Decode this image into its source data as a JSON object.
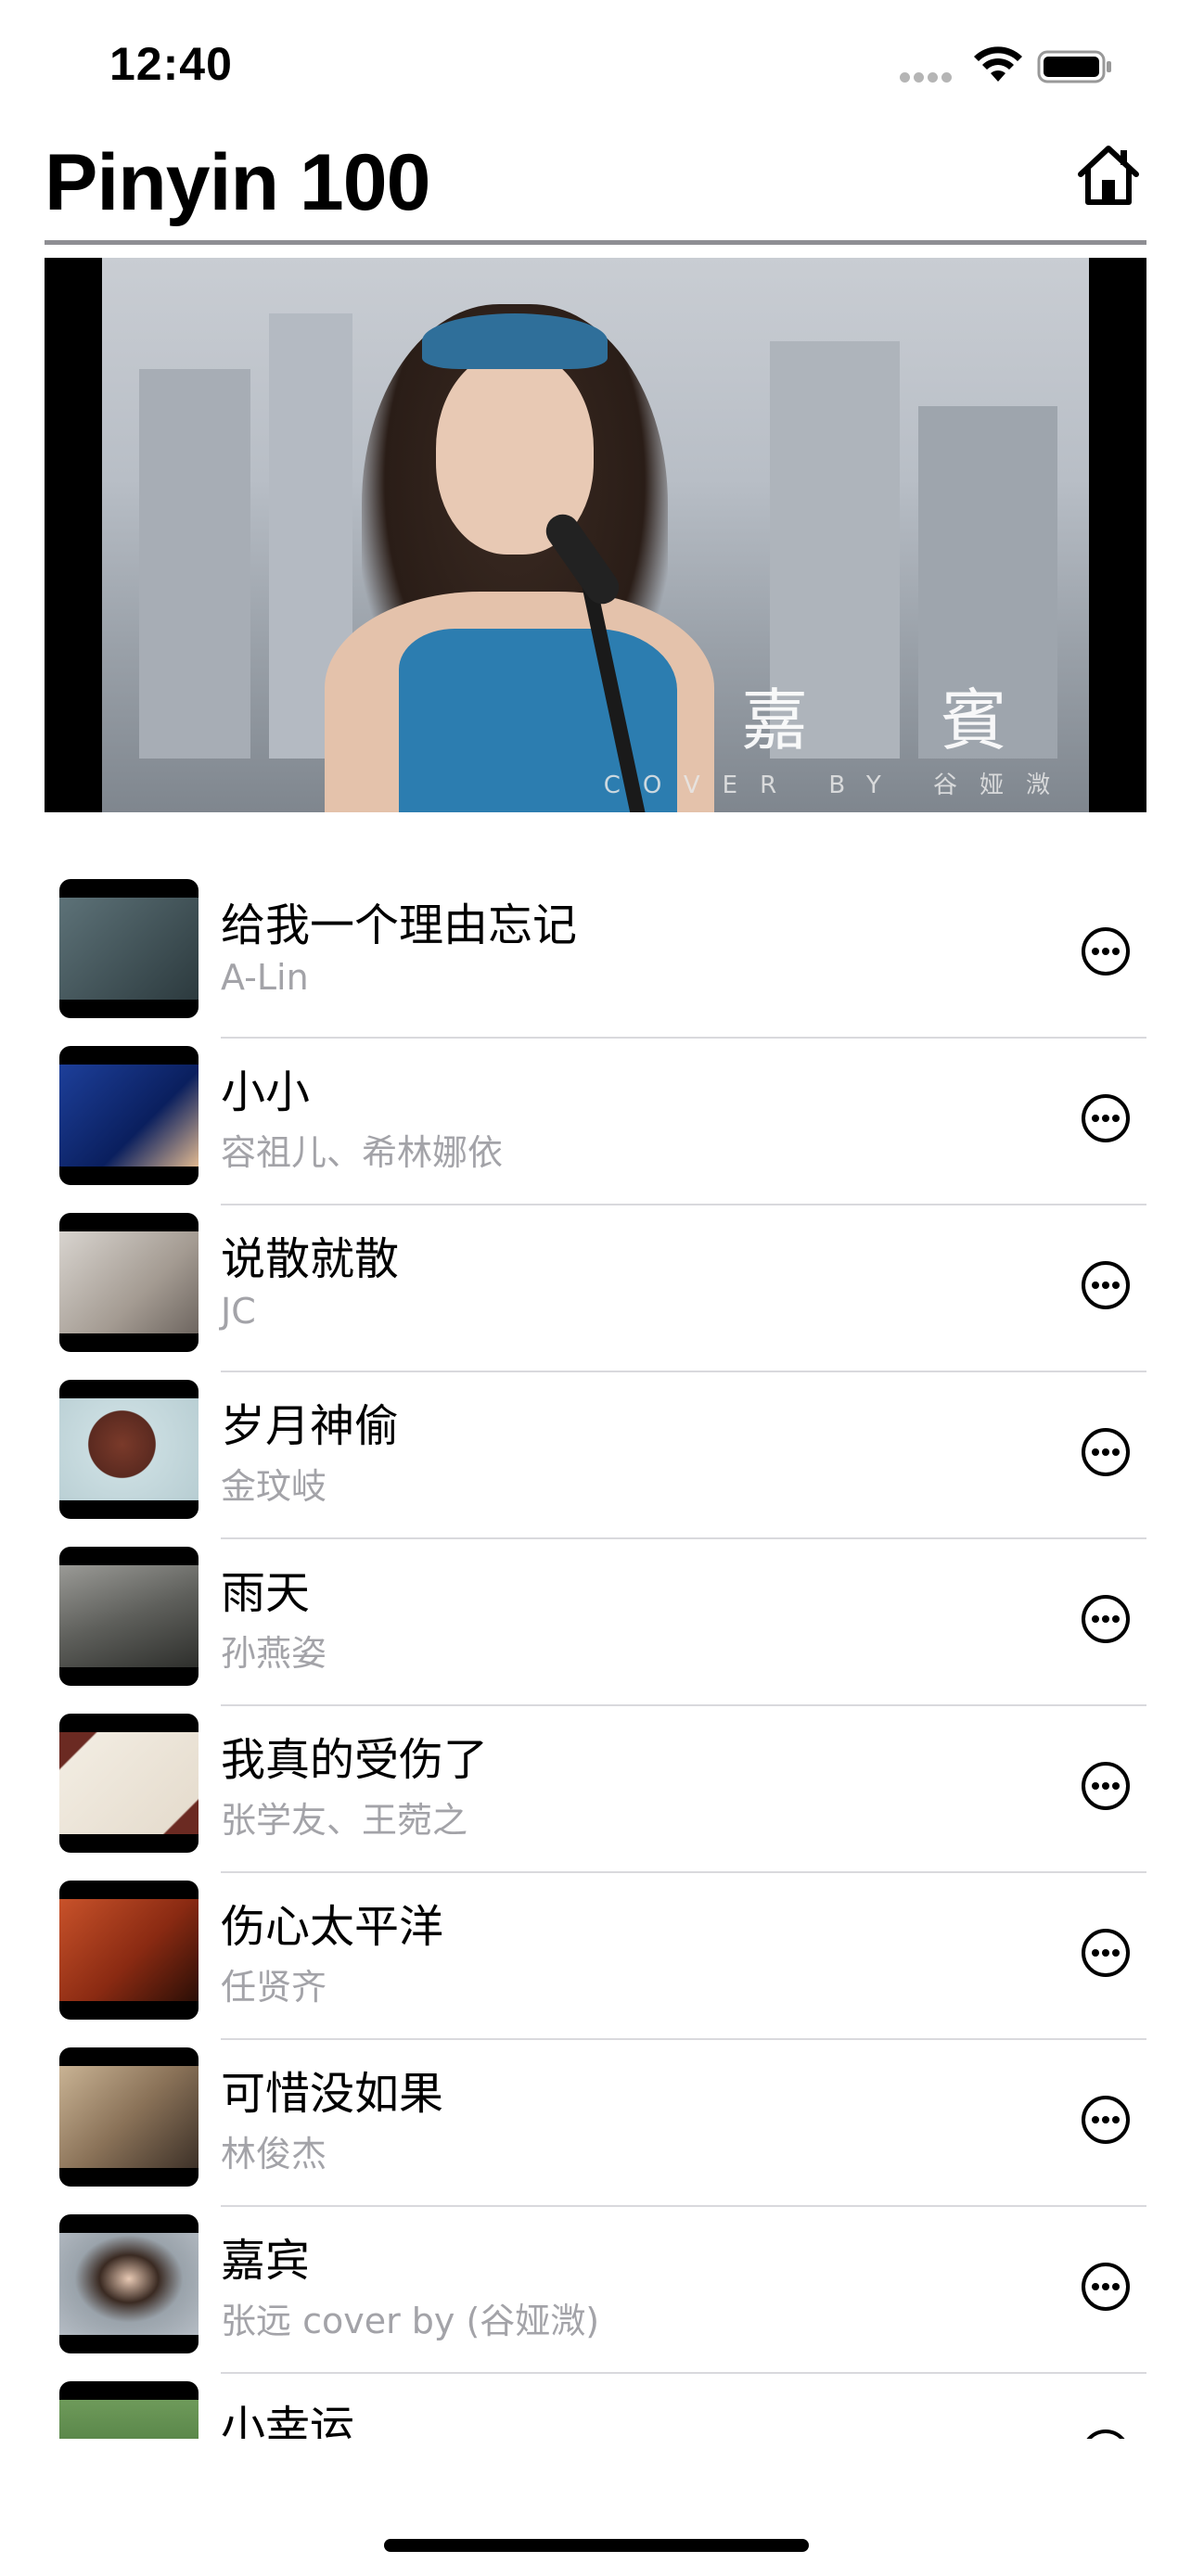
{
  "status_bar": {
    "time": "12:40"
  },
  "header": {
    "title": "Pinyin 100"
  },
  "video": {
    "overlay_title": "嘉 賓",
    "overlay_sub": "COVER BY 谷娅溦"
  },
  "songs": [
    {
      "title": "给我一个理由忘记",
      "artist": "A-Lin"
    },
    {
      "title": "小小",
      "artist": "容祖儿、希林娜依"
    },
    {
      "title": "说散就散",
      "artist": "JC"
    },
    {
      "title": "岁月神偷",
      "artist": "金玟岐"
    },
    {
      "title": "雨天",
      "artist": "孙燕姿"
    },
    {
      "title": "我真的受伤了",
      "artist": "张学友、王菀之"
    },
    {
      "title": "伤心太平洋",
      "artist": "任贤齐"
    },
    {
      "title": "可惜没如果",
      "artist": "林俊杰"
    },
    {
      "title": "嘉宾",
      "artist": "张远 cover by (谷娅溦)"
    },
    {
      "title": "小幸运",
      "artist": ""
    }
  ],
  "colors": {
    "secondary_text": "#a3a3a8",
    "divider": "#d9d9dd",
    "header_rule": "#8e8e93"
  },
  "icons": {
    "home": "home-icon",
    "more": "more-circle-icon",
    "wifi": "wifi-icon",
    "battery": "battery-icon",
    "signal": "signal-dots-icon"
  }
}
